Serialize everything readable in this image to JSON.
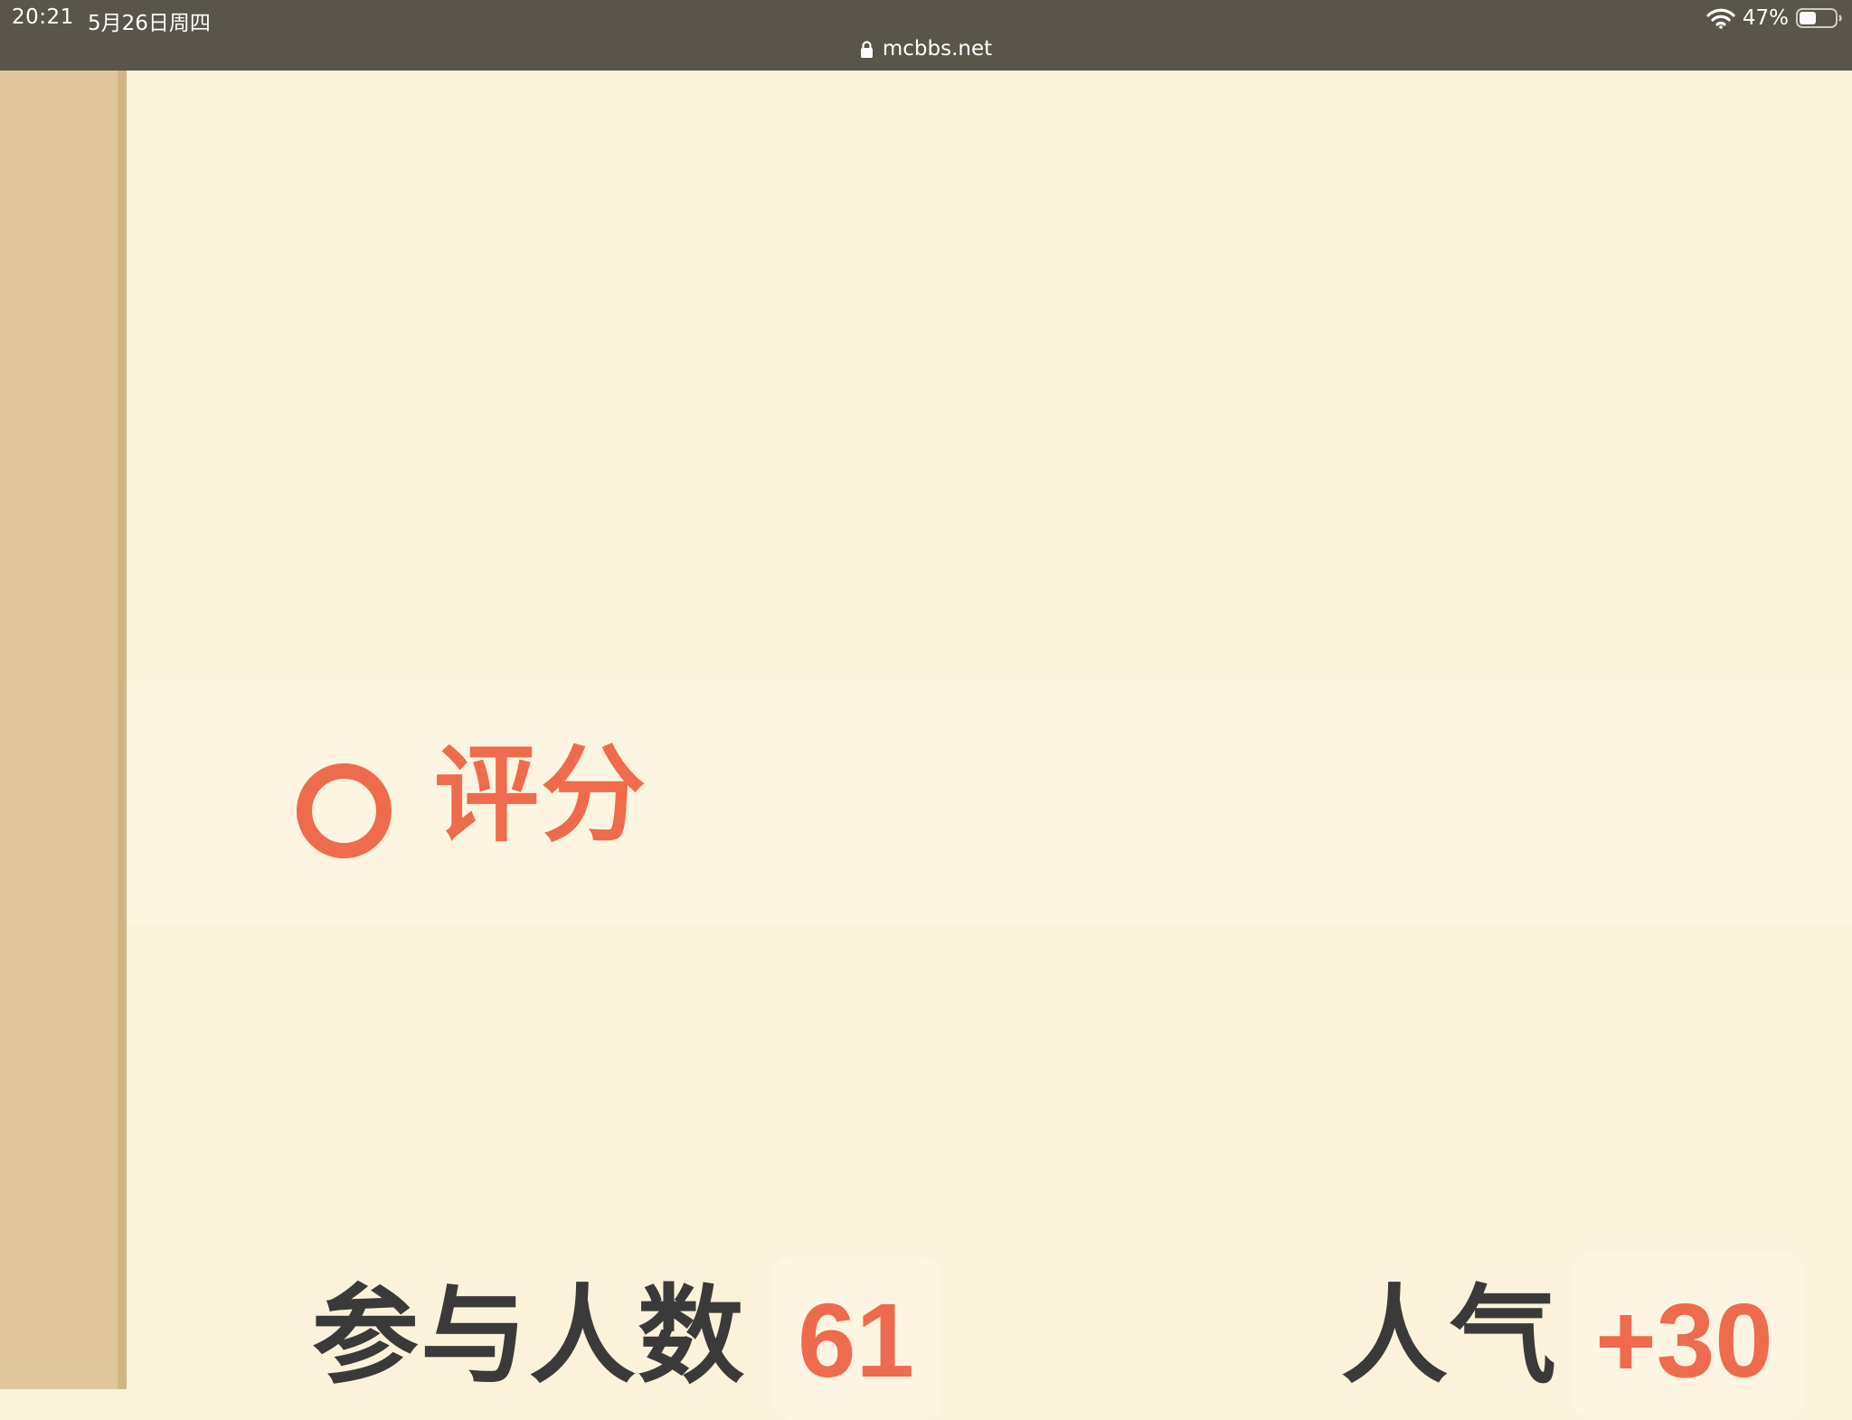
{
  "status_bar": {
    "time": "20:21",
    "date": "5月26日周四",
    "url": "mcbbs.net",
    "battery_percent": "47%",
    "battery_level": 0.47,
    "icons": [
      "lock-icon",
      "wifi-icon",
      "battery-icon"
    ]
  },
  "rating_section": {
    "title": "评分",
    "marker_icon": "ring-icon",
    "accent_color": "#ee6b4d"
  },
  "stats": {
    "participants_label": "参与人数",
    "participants_value": "61",
    "popularity_label": "人气",
    "popularity_value": "+30"
  },
  "colors": {
    "status_bar_bg": "#59554a",
    "page_bg": "#fbf2dc",
    "sidebar_bg": "#e1c89c",
    "accent": "#ee6b4d",
    "text_dark": "#3a3a3a"
  }
}
